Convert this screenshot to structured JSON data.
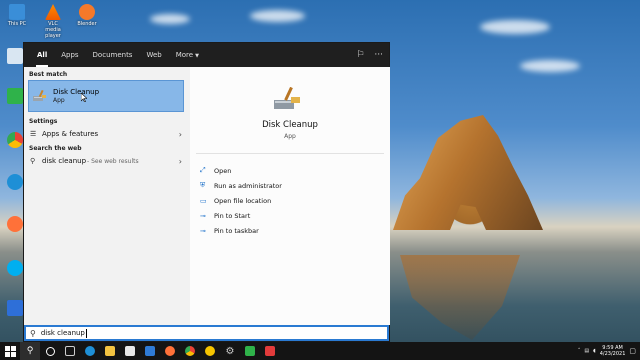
{
  "desktop": {
    "icons": [
      {
        "label": "This PC"
      },
      {
        "label": "VLC media player"
      },
      {
        "label": "Blender"
      },
      {
        "label": "Recycle Bin"
      },
      {
        "label": "Camtasia"
      },
      {
        "label": "Google Chrome"
      },
      {
        "label": "Microsoft Edge"
      },
      {
        "label": "Mozilla Firefox"
      },
      {
        "label": "Skype"
      },
      {
        "label": "Wondershare"
      }
    ]
  },
  "search": {
    "tabs": [
      "All",
      "Apps",
      "Documents",
      "Web",
      "More"
    ],
    "best_match_title": "Best match",
    "best_match": {
      "name": "Disk Cleanup",
      "type": "App"
    },
    "settings_title": "Settings",
    "settings_item": "Apps & features",
    "web_title": "Search the web",
    "web_query": "disk cleanup",
    "web_suffix": "- See web results",
    "detail": {
      "title": "Disk Cleanup",
      "subtitle": "App",
      "actions": [
        "Open",
        "Run as administrator",
        "Open file location",
        "Pin to Start",
        "Pin to taskbar"
      ]
    },
    "input_value": "disk cleanup"
  },
  "taskbar": {
    "time": "9:59 AM",
    "date": "4/23/2021"
  },
  "colors": {
    "accent": "#2a7ad2",
    "selection": "#87b7e8"
  }
}
